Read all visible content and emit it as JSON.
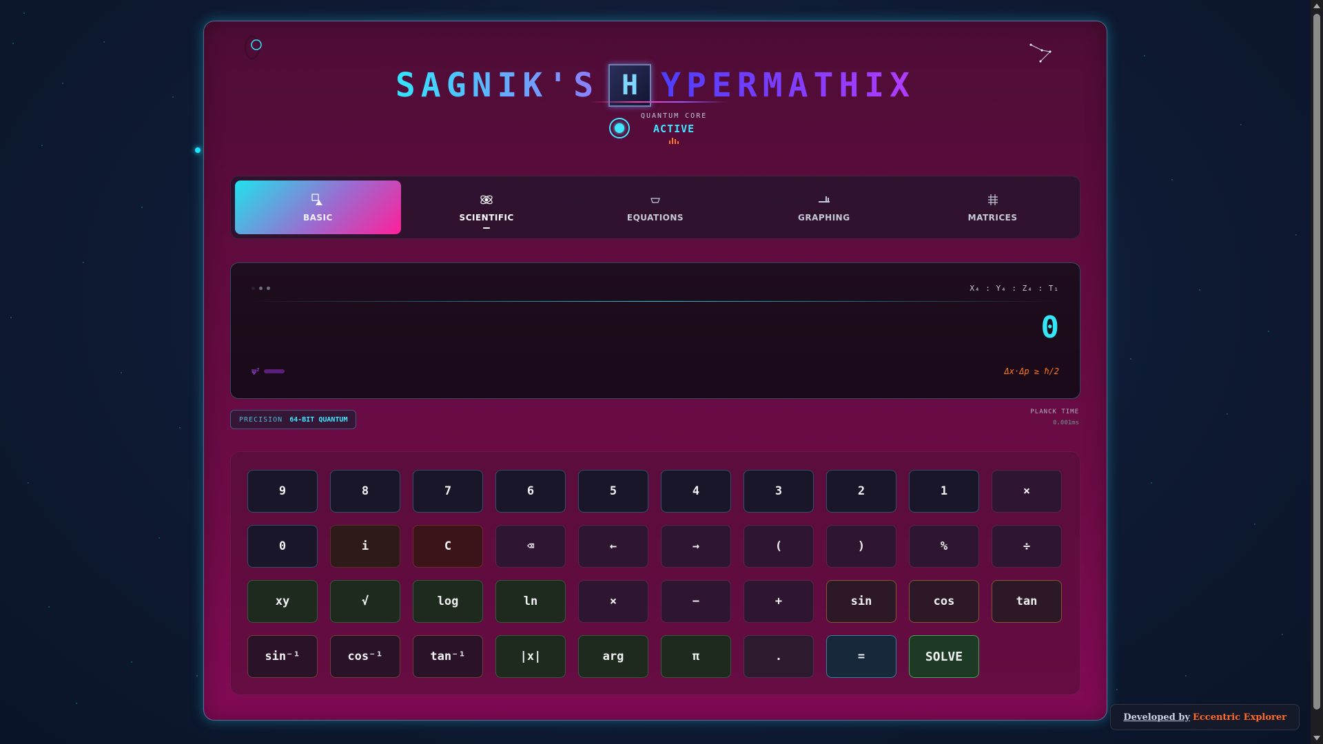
{
  "header": {
    "title_part1": "SAGNIK'S",
    "title_logo_letter": "H",
    "title_part2": "YPERMATHIX",
    "core_label": "QUANTUM CORE",
    "core_status": "ACTIVE"
  },
  "tabs": [
    {
      "label": "BASIC",
      "icon": "shapes-icon",
      "active": true
    },
    {
      "label": "SCIENTIFIC",
      "icon": "atom-icon",
      "active": false
    },
    {
      "label": "EQUATIONS",
      "icon": "cup-icon",
      "active": false
    },
    {
      "label": "GRAPHING",
      "icon": "bar-graph-icon",
      "active": false
    },
    {
      "label": "MATRICES",
      "icon": "grid-icon",
      "active": false
    }
  ],
  "display": {
    "coords": "X₄ : Y₄ : Z₄ : T₁",
    "value": "0",
    "psi": "ψ²",
    "uncertainty": "Δx·Δp ≥ ℏ/2"
  },
  "precision": {
    "label": "PRECISION",
    "value": "64-BIT QUANTUM"
  },
  "planck": {
    "label": "PLANCK TIME",
    "value": "0.001ms"
  },
  "keys": [
    {
      "label": "9",
      "type": "num"
    },
    {
      "label": "8",
      "type": "num"
    },
    {
      "label": "7",
      "type": "num"
    },
    {
      "label": "6",
      "type": "num"
    },
    {
      "label": "5",
      "type": "num"
    },
    {
      "label": "4",
      "type": "num"
    },
    {
      "label": "3",
      "type": "num"
    },
    {
      "label": "2",
      "type": "num"
    },
    {
      "label": "1",
      "type": "num"
    },
    {
      "label": "×",
      "type": "op"
    },
    {
      "label": "0",
      "type": "num"
    },
    {
      "label": "i",
      "type": "inv"
    },
    {
      "label": "C",
      "type": "clear"
    },
    {
      "label": "⌫",
      "type": "op"
    },
    {
      "label": "←",
      "type": "op"
    },
    {
      "label": "→",
      "type": "op"
    },
    {
      "label": "(",
      "type": "op"
    },
    {
      "label": ")",
      "type": "op"
    },
    {
      "label": "%",
      "type": "op"
    },
    {
      "label": "÷",
      "type": "op"
    },
    {
      "label": "xy",
      "type": "fn"
    },
    {
      "label": "√",
      "type": "fn"
    },
    {
      "label": "log",
      "type": "fn"
    },
    {
      "label": "ln",
      "type": "fn"
    },
    {
      "label": "×",
      "type": "op"
    },
    {
      "label": "−",
      "type": "op"
    },
    {
      "label": "+",
      "type": "op"
    },
    {
      "label": "sin",
      "type": "trig"
    },
    {
      "label": "cos",
      "type": "trig"
    },
    {
      "label": "tan",
      "type": "trig"
    },
    {
      "label": "sin⁻¹",
      "type": "itrig"
    },
    {
      "label": "cos⁻¹",
      "type": "itrig"
    },
    {
      "label": "tan⁻¹",
      "type": "itrig"
    },
    {
      "label": "|x|",
      "type": "fn"
    },
    {
      "label": "arg",
      "type": "fn"
    },
    {
      "label": "π",
      "type": "fn"
    },
    {
      "label": ".",
      "type": "dot"
    },
    {
      "label": "=",
      "type": "eq"
    },
    {
      "label": "SOLVE",
      "type": "solve"
    }
  ],
  "credit": {
    "prefix": "Developed by",
    "name": "Eccentric Explorer"
  },
  "colors": {
    "accent_cyan": "#33e6f5",
    "accent_pink": "#ff1f9a",
    "panel": "#6e0b47",
    "warning_orange": "#ff7a1a"
  }
}
